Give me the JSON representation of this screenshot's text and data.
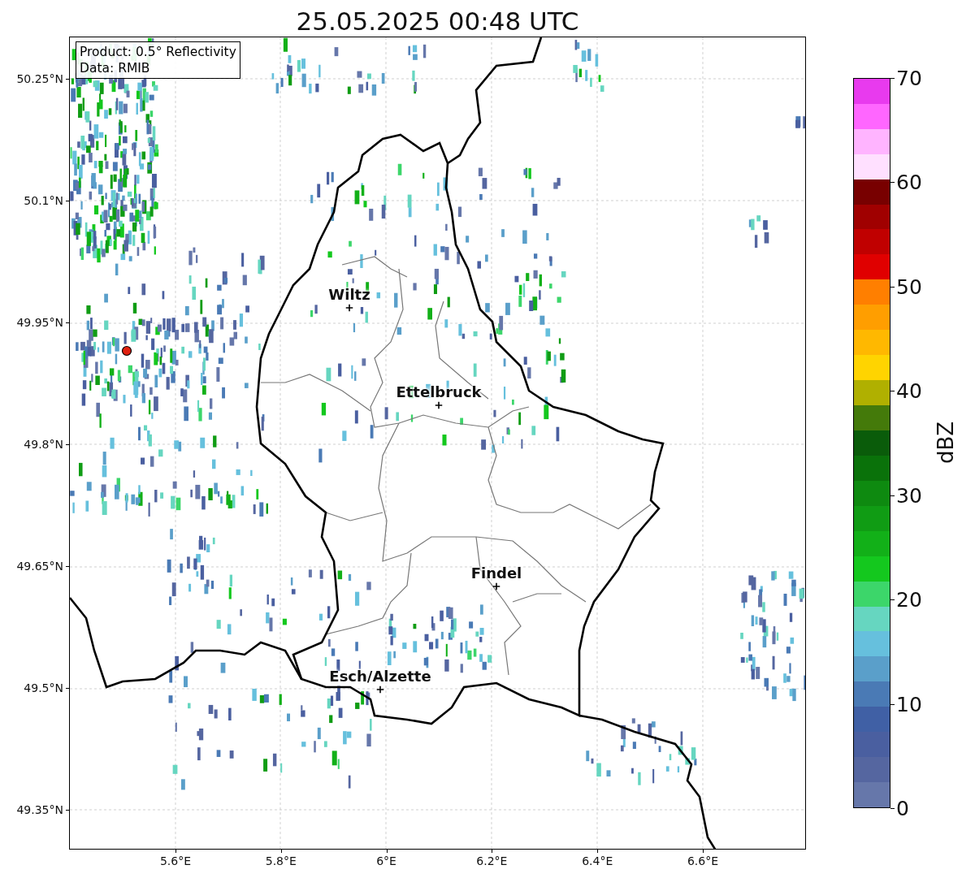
{
  "title": "25.05.2025 00:48 UTC",
  "info_box": {
    "lines": [
      "Product: 0.5° Reflectivity",
      "Data: RMIB"
    ]
  },
  "map": {
    "lat_ticks": [
      "50.25°N",
      "50.1°N",
      "49.95°N",
      "49.8°N",
      "49.65°N",
      "49.5°N",
      "49.35°N"
    ],
    "lon_ticks": [
      "5.6°E",
      "5.8°E",
      "6°E",
      "6.2°E",
      "6.4°E",
      "6.6°E"
    ],
    "cities": [
      {
        "name": "Wiltz"
      },
      {
        "name": "Ettelbruck"
      },
      {
        "name": "Findel"
      },
      {
        "name": "Esch/Alzette"
      }
    ]
  },
  "colorbar": {
    "label": "dBZ",
    "ticks": [
      "70",
      "60",
      "50",
      "40",
      "30",
      "20",
      "10",
      "0"
    ],
    "bins": [
      {
        "color": "#6677aa"
      },
      {
        "color": "#5566a0"
      },
      {
        "color": "#4a5fa0"
      },
      {
        "color": "#4060a5"
      },
      {
        "color": "#4a7ab5"
      },
      {
        "color": "#5a9fca"
      },
      {
        "color": "#66c0dd"
      },
      {
        "color": "#66d6c0"
      },
      {
        "color": "#3cd66a"
      },
      {
        "color": "#14c81e"
      },
      {
        "color": "#12b018"
      },
      {
        "color": "#109c14"
      },
      {
        "color": "#0e8a10"
      },
      {
        "color": "#0a720a"
      },
      {
        "color": "#0a5c0a"
      },
      {
        "color": "#447a0a"
      },
      {
        "color": "#b0b000"
      },
      {
        "color": "#ffd400"
      },
      {
        "color": "#ffb800"
      },
      {
        "color": "#ff9e00"
      },
      {
        "color": "#ff7f00"
      },
      {
        "color": "#e00000"
      },
      {
        "color": "#c00000"
      },
      {
        "color": "#a00000"
      },
      {
        "color": "#780000"
      },
      {
        "color": "#ffe0ff"
      },
      {
        "color": "#ffb4ff"
      },
      {
        "color": "#ff66ff"
      },
      {
        "color": "#e83aee"
      }
    ]
  }
}
